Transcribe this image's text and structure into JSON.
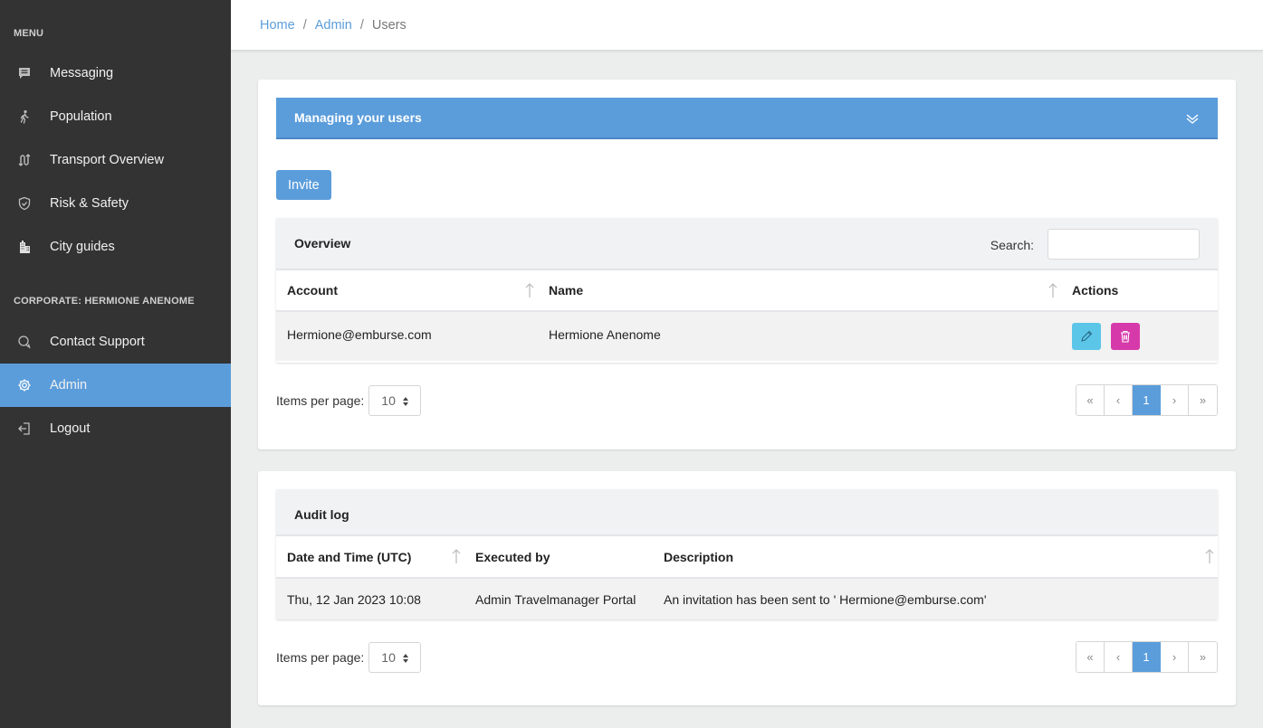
{
  "sidebar": {
    "menu_heading": "MENU",
    "corp_heading": "CORPORATE: HERMIONE ANENOME",
    "items": [
      {
        "label": "Messaging",
        "icon": "message-icon"
      },
      {
        "label": "Population",
        "icon": "walking-person-icon"
      },
      {
        "label": "Transport Overview",
        "icon": "route-icon"
      },
      {
        "label": "Risk & Safety",
        "icon": "shield-icon"
      },
      {
        "label": "City guides",
        "icon": "buildings-icon"
      },
      {
        "label": "Contact Support",
        "icon": "chat-bubbles-icon"
      },
      {
        "label": "Admin",
        "icon": "gear-icon"
      },
      {
        "label": "Logout",
        "icon": "logout-icon"
      }
    ],
    "accent_color": "#5b9ddb",
    "background_color": "#333333"
  },
  "breadcrumb": {
    "home": "Home",
    "admin": "Admin",
    "current": "Users",
    "separator": "/"
  },
  "users_card": {
    "banner_title": "Managing your users",
    "invite_label": "Invite",
    "overview": {
      "title": "Overview",
      "search_label": "Search:",
      "search_value": "",
      "columns": {
        "account": "Account",
        "name": "Name",
        "actions": "Actions"
      },
      "rows": [
        {
          "account": "Hermione@emburse.com",
          "name": "Hermione Anenome"
        }
      ]
    },
    "items_per_page_label": "Items per page:",
    "items_per_page_value": "10",
    "pagination": {
      "first": "«",
      "prev": "‹",
      "current": "1",
      "next": "›",
      "last": "»"
    }
  },
  "audit_card": {
    "title": "Audit log",
    "columns": {
      "datetime": "Date and Time (UTC)",
      "executed_by": "Executed by",
      "description": "Description"
    },
    "rows": [
      {
        "datetime": "Thu, 12 Jan 2023 10:08",
        "executed_by": "Admin Travelmanager Portal",
        "description": "An invitation has been sent to ' Hermione@emburse.com'"
      }
    ],
    "items_per_page_label": "Items per page:",
    "items_per_page_value": "10",
    "pagination": {
      "first": "«",
      "prev": "‹",
      "current": "1",
      "next": "›",
      "last": "»"
    }
  }
}
